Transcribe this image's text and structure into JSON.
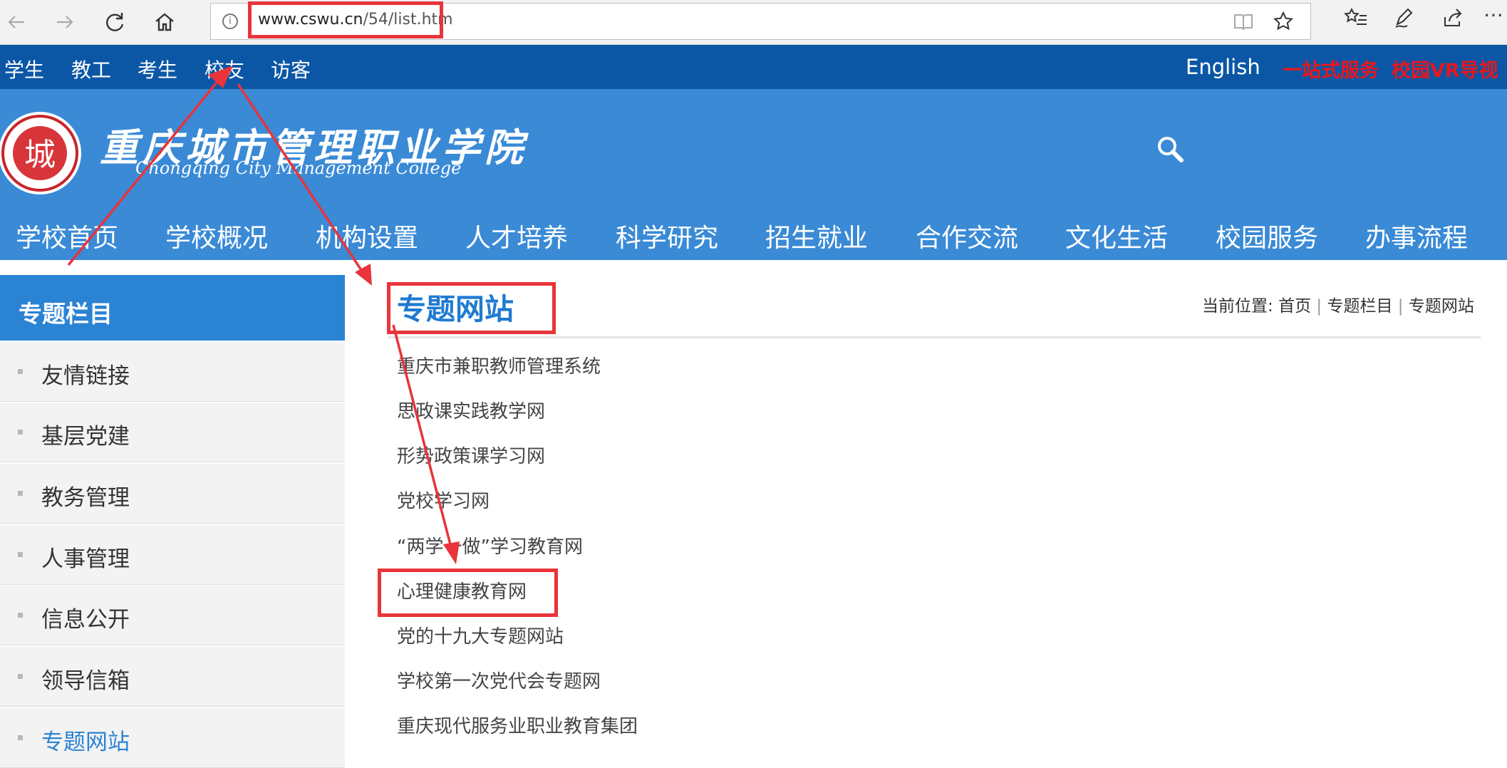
{
  "browser": {
    "url_host": "www.cswu.cn",
    "url_path": "/54/list.htm",
    "back_icon": "arrow-left-icon",
    "forward_icon": "arrow-right-icon",
    "refresh_icon": "refresh-icon",
    "home_icon": "home-icon",
    "info_icon": "info-icon",
    "reading_view_icon": "book-icon",
    "favorite_icon": "star-icon",
    "favorites_list_icon": "favorites-list-icon",
    "notes_icon": "pen-icon",
    "share_icon": "share-icon",
    "more_icon": "more-icon"
  },
  "topbar": {
    "links": [
      "学生",
      "教工",
      "考生",
      "校友",
      "访客"
    ],
    "english": "English",
    "red_links": [
      "一站式服务",
      "校园VR导视"
    ],
    "background": "#0b57a6",
    "red_color": "#e8171d"
  },
  "header": {
    "logo_cn": "重庆城市管理职业学院",
    "logo_en": "Chongqing City Management College",
    "seal_char": "城",
    "search_icon": "search-icon",
    "background": "#3a8ad6"
  },
  "mainnav": {
    "items": [
      "学校首页",
      "学校概况",
      "机构设置",
      "人才培养",
      "科学研究",
      "招生就业",
      "合作交流",
      "文化生活",
      "校园服务",
      "办事流程"
    ]
  },
  "sidebar": {
    "title": "专题栏目",
    "items": [
      {
        "label": "友情链接",
        "active": false
      },
      {
        "label": "基层党建",
        "active": false
      },
      {
        "label": "教务管理",
        "active": false
      },
      {
        "label": "人事管理",
        "active": false
      },
      {
        "label": "信息公开",
        "active": false
      },
      {
        "label": "领导信箱",
        "active": false
      },
      {
        "label": "专题网站",
        "active": true
      }
    ],
    "accent": "#2b83d4"
  },
  "main": {
    "title": "专题网站",
    "breadcrumb": {
      "prefix": "当前位置:",
      "items": [
        "首页",
        "专题栏目",
        "专题网站"
      ]
    },
    "links": [
      "重庆市兼职教师管理系统",
      "思政课实践教学网",
      "形势政策课学习网",
      "党校学习网",
      "“两学一做”学习教育网",
      "心理健康教育网",
      "党的十九大专题网站",
      "学校第一次党代会专题网",
      "重庆现代服务业职业教育集团"
    ]
  },
  "annotation_color": "#e8343a"
}
